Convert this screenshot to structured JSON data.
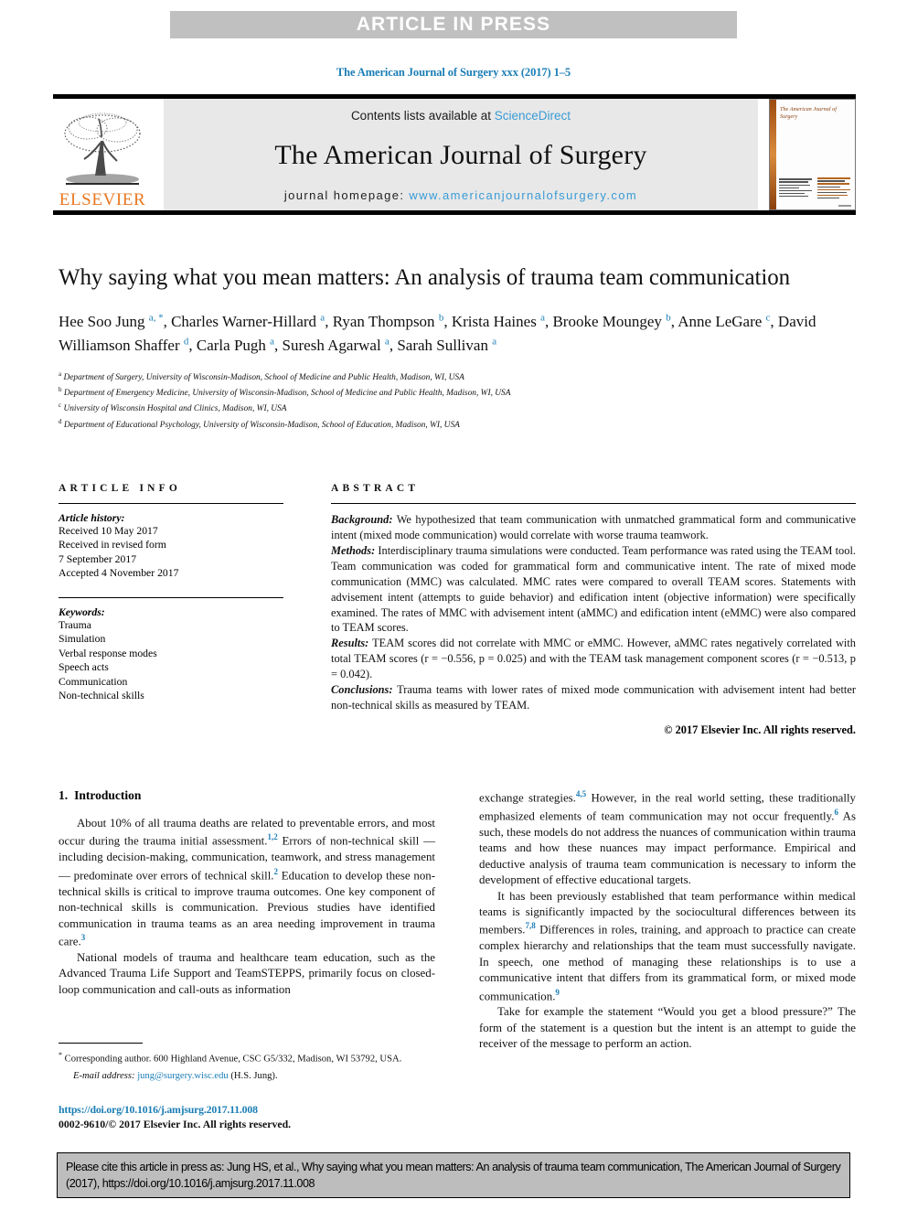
{
  "banner": {
    "text": "ARTICLE IN PRESS"
  },
  "running_head": "The American Journal of Surgery xxx (2017) 1–5",
  "masthead": {
    "contents_prefix": "Contents lists available at ",
    "contents_link": "ScienceDirect",
    "journal_title": "The American Journal of Surgery",
    "homepage_prefix": "journal homepage: ",
    "homepage_url": "www.americanjournalofsurgery.com",
    "publisher_wordmark": "ELSEVIER",
    "cover_title": "The American Journal of Surgery",
    "accent_orange": "#e87722",
    "link_blue": "#3a9bd5"
  },
  "article": {
    "title": "Why saying what you mean matters: An analysis of trauma team communication",
    "authors_line1": "Hee Soo Jung",
    "authors": [
      {
        "name": "Hee Soo Jung",
        "marks": "a, *"
      },
      {
        "name": "Charles Warner-Hillard",
        "marks": "a"
      },
      {
        "name": "Ryan Thompson",
        "marks": "b"
      },
      {
        "name": "Krista Haines",
        "marks": "a"
      },
      {
        "name": "Brooke Moungey",
        "marks": "b"
      },
      {
        "name": "Anne LeGare",
        "marks": "c"
      },
      {
        "name": "David Williamson Shaffer",
        "marks": "d"
      },
      {
        "name": "Carla Pugh",
        "marks": "a"
      },
      {
        "name": "Suresh Agarwal",
        "marks": "a"
      },
      {
        "name": "Sarah Sullivan",
        "marks": "a"
      }
    ],
    "affiliations": [
      {
        "mark": "a",
        "text": "Department of Surgery, University of Wisconsin-Madison, School of Medicine and Public Health, Madison, WI, USA"
      },
      {
        "mark": "b",
        "text": "Department of Emergency Medicine, University of Wisconsin-Madison, School of Medicine and Public Health, Madison, WI, USA"
      },
      {
        "mark": "c",
        "text": "University of Wisconsin Hospital and Clinics, Madison, WI, USA"
      },
      {
        "mark": "d",
        "text": "Department of Educational Psychology, University of Wisconsin-Madison, School of Education, Madison, WI, USA"
      }
    ]
  },
  "article_info": {
    "heading": "ARTICLE INFO",
    "history_label": "Article history:",
    "history": [
      "Received 10 May 2017",
      "Received in revised form",
      "7 September 2017",
      "Accepted 4 November 2017"
    ],
    "keywords_label": "Keywords:",
    "keywords": [
      "Trauma",
      "Simulation",
      "Verbal response modes",
      "Speech acts",
      "Communication",
      "Non-technical skills"
    ]
  },
  "abstract": {
    "heading": "ABSTRACT",
    "sections": [
      {
        "label": "Background:",
        "text": " We hypothesized that team communication with unmatched grammatical form and communicative intent (mixed mode communication) would correlate with worse trauma teamwork."
      },
      {
        "label": "Methods:",
        "text": " Interdisciplinary trauma simulations were conducted. Team performance was rated using the TEAM tool. Team communication was coded for grammatical form and communicative intent. The rate of mixed mode communication (MMC) was calculated. MMC rates were compared to overall TEAM scores. Statements with advisement intent (attempts to guide behavior) and edification intent (objective information) were specifically examined. The rates of MMC with advisement intent (aMMC) and edification intent (eMMC) were also compared to TEAM scores."
      },
      {
        "label": "Results:",
        "text": " TEAM scores did not correlate with MMC or eMMC. However, aMMC rates negatively correlated with total TEAM scores (r = −0.556, p = 0.025) and with the TEAM task management component scores (r = −0.513, p = 0.042)."
      },
      {
        "label": "Conclusions:",
        "text": " Trauma teams with lower rates of mixed mode communication with advisement intent had better non-technical skills as measured by TEAM."
      }
    ],
    "copyright": "© 2017 Elsevier Inc. All rights reserved."
  },
  "body": {
    "section_number": "1.",
    "section_title": "Introduction",
    "left_paragraphs": [
      {
        "parts": [
          {
            "t": "About 10% of all trauma deaths are related to preventable errors, and most occur during the trauma initial assessment."
          },
          {
            "ref": "1,2"
          },
          {
            "t": " Errors of non-technical skill — including decision-making, communication, teamwork, and stress management — predominate over errors of technical skill."
          },
          {
            "ref": "2"
          },
          {
            "t": " Education to develop these non-technical skills is critical to improve trauma outcomes. One key component of non-technical skills is communication. Previous studies have identified communication in trauma teams as an area needing improvement in trauma care."
          },
          {
            "ref": "3"
          }
        ]
      },
      {
        "parts": [
          {
            "t": "National models of trauma and healthcare team education, such as the Advanced Trauma Life Support and TeamSTEPPS, primarily focus on closed-loop communication and call-outs as information"
          }
        ]
      }
    ],
    "right_paragraphs": [
      {
        "parts": [
          {
            "t": "exchange strategies."
          },
          {
            "ref": "4,5"
          },
          {
            "t": " However, in the real world setting, these traditionally emphasized elements of team communication may not occur frequently."
          },
          {
            "ref": "6"
          },
          {
            "t": " As such, these models do not address the nuances of communication within trauma teams and how these nuances may impact performance. Empirical and deductive analysis of trauma team communication is necessary to inform the development of effective educational targets."
          }
        ],
        "indent": false
      },
      {
        "parts": [
          {
            "t": "It has been previously established that team performance within medical teams is significantly impacted by the sociocultural differences between its members."
          },
          {
            "ref": "7,8"
          },
          {
            "t": " Differences in roles, training, and approach to practice can create complex hierarchy and relationships that the team must successfully navigate. In speech, one method of managing these relationships is to use a communicative intent that differs from its grammatical form, or mixed mode communication."
          },
          {
            "ref": "9"
          }
        ],
        "indent": true
      },
      {
        "parts": [
          {
            "t": "Take for example the statement “Would you get a blood pressure?” The form of the statement is a question but the intent is an attempt to guide the receiver of the message to perform an action."
          }
        ],
        "indent": true
      }
    ]
  },
  "footnote": {
    "star": "*",
    "corresponding": " Corresponding author. 600 Highland Avenue, CSC G5/332, Madison, WI 53792, USA.",
    "email_label": "E-mail address:",
    "email": "jung@surgery.wisc.edu",
    "email_suffix": " (H.S. Jung)."
  },
  "doi": {
    "url": "https://doi.org/10.1016/j.amjsurg.2017.11.008",
    "issn_line": "0002-9610/© 2017 Elsevier Inc. All rights reserved."
  },
  "citation_footer": {
    "text": "Please cite this article in press as: Jung HS, et al., Why saying what you mean matters: An analysis of trauma team communication, The American Journal of Surgery (2017), https://doi.org/10.1016/j.amjsurg.2017.11.008"
  }
}
